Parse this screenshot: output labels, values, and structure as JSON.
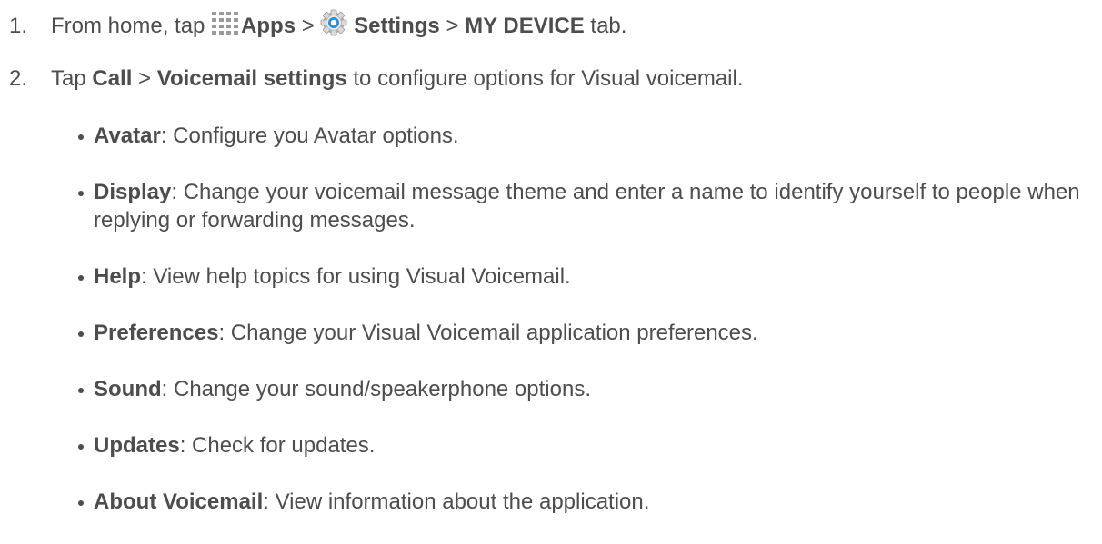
{
  "step1": {
    "number": "1.",
    "pre": "From home, tap ",
    "apps_label": "Apps",
    "sep1": " > ",
    "settings_label": "Settings",
    "sep2": " > ",
    "tab_label": "MY DEVICE",
    "post": " tab."
  },
  "step2": {
    "number": "2.",
    "pre": "Tap ",
    "call_label": "Call",
    "sep": " > ",
    "voicemail_label": "Voicemail settings",
    "post": " to configure options for Visual voicemail."
  },
  "bullets": [
    {
      "term": "Avatar",
      "desc": ": Configure you Avatar options."
    },
    {
      "term": "Display",
      "desc": ": Change your voicemail message theme and enter a name to identify yourself to people when replying or forwarding messages."
    },
    {
      "term": "Help",
      "desc": ": View help topics for using Visual Voicemail."
    },
    {
      "term": "Preferences",
      "desc": ": Change your Visual Voicemail application preferences."
    },
    {
      "term": "Sound",
      "desc": ": Change your sound/speakerphone options."
    },
    {
      "term": "Updates",
      "desc": ": Check for updates."
    },
    {
      "term": "About Voicemail",
      "desc": ": View information about the application."
    }
  ],
  "icons": {
    "apps": "apps-grid-icon",
    "settings": "settings-gear-icon"
  }
}
